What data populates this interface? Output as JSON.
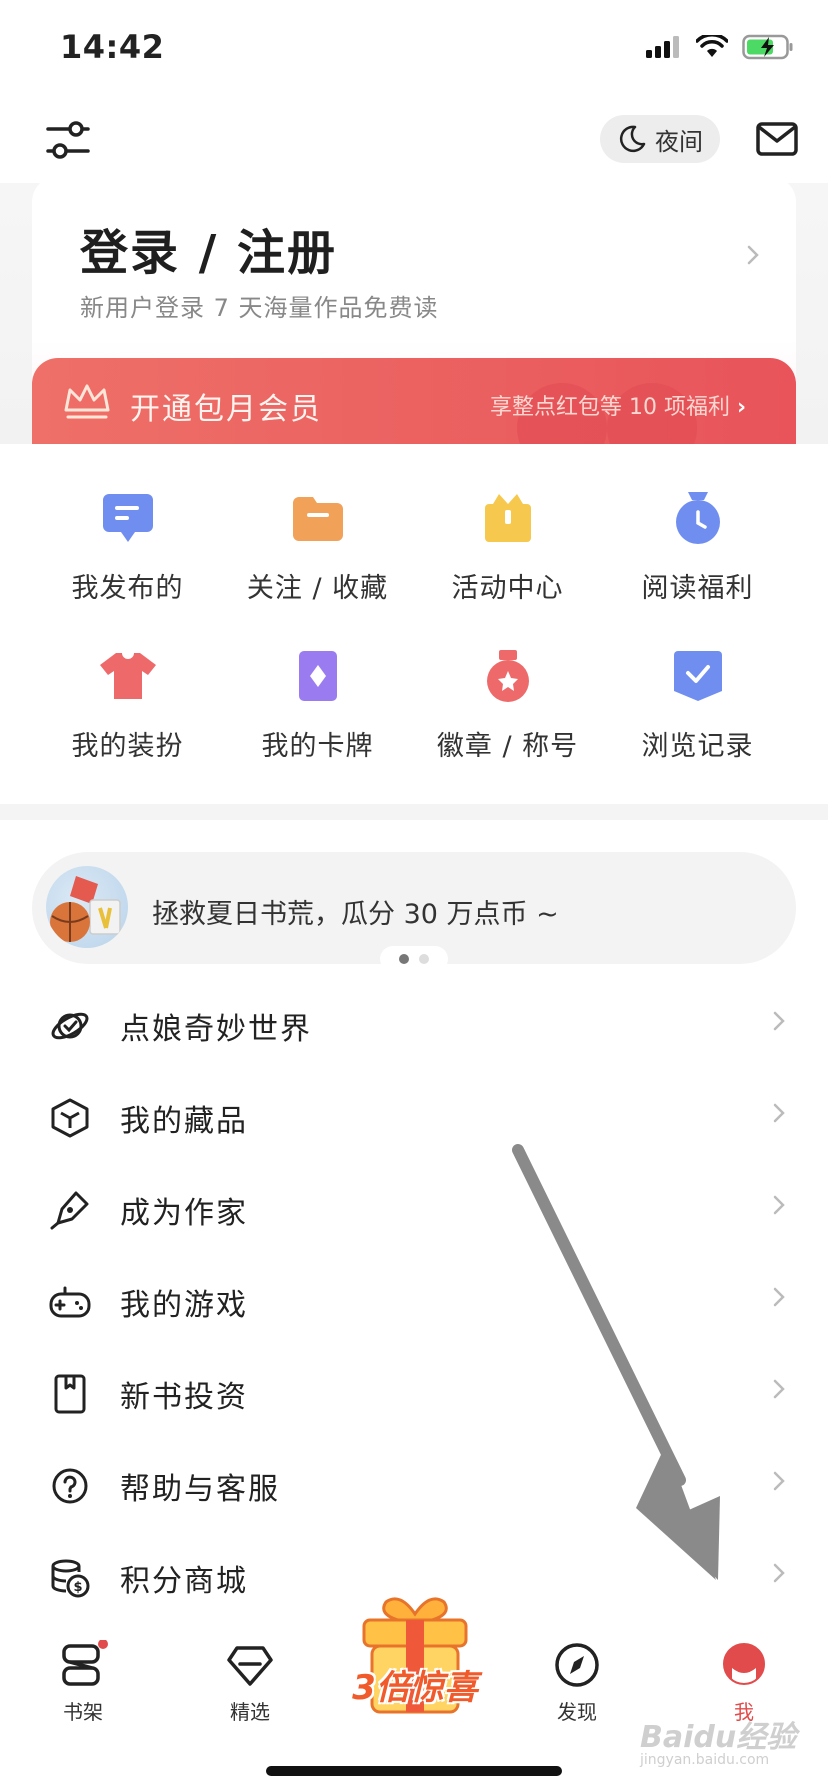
{
  "status": {
    "time": "14:42"
  },
  "header": {
    "night_label": "夜间"
  },
  "login": {
    "title": "登录 / 注册",
    "subtitle": "新用户登录 7 天海量作品免费读"
  },
  "vip": {
    "title": "开通包月会员",
    "benefit": "享整点红包等 10 项福利"
  },
  "grid": [
    {
      "label": "我发布的",
      "icon": "message-icon",
      "color": "#6f8ef0"
    },
    {
      "label": "关注 / 收藏",
      "icon": "folder-icon",
      "color": "#f2a159"
    },
    {
      "label": "活动中心",
      "icon": "gift-box-icon",
      "color": "#f6c94e"
    },
    {
      "label": "阅读福利",
      "icon": "clock-bag-icon",
      "color": "#6f8ef0"
    },
    {
      "label": "我的装扮",
      "icon": "tshirt-icon",
      "color": "#ee6a6a"
    },
    {
      "label": "我的卡牌",
      "icon": "card-icon",
      "color": "#9b7cf0"
    },
    {
      "label": "徽章 / 称号",
      "icon": "medal-icon",
      "color": "#ee6a6a"
    },
    {
      "label": "浏览记录",
      "icon": "history-icon",
      "color": "#6f8ef0"
    }
  ],
  "banner": {
    "text": "拯救夏日书荒，瓜分 30 万点币 ~"
  },
  "menu": [
    {
      "label": "点娘奇妙世界",
      "icon": "orbit-icon"
    },
    {
      "label": "我的藏品",
      "icon": "cube-icon"
    },
    {
      "label": "成为作家",
      "icon": "pen-icon"
    },
    {
      "label": "我的游戏",
      "icon": "gamepad-icon"
    },
    {
      "label": "新书投资",
      "icon": "bookmark-icon"
    },
    {
      "label": "帮助与客服",
      "icon": "help-icon"
    },
    {
      "label": "积分商城",
      "icon": "coins-icon"
    }
  ],
  "nav": {
    "bookshelf": "书架",
    "featured": "精选",
    "promo": "3倍惊喜",
    "discover": "发现",
    "me": "我"
  },
  "colors": {
    "accent_red": "#e8545a",
    "nav_active": "#e24b4b"
  },
  "watermark": {
    "brand": "Baidu经验",
    "url": "jingyan.baidu.com"
  }
}
